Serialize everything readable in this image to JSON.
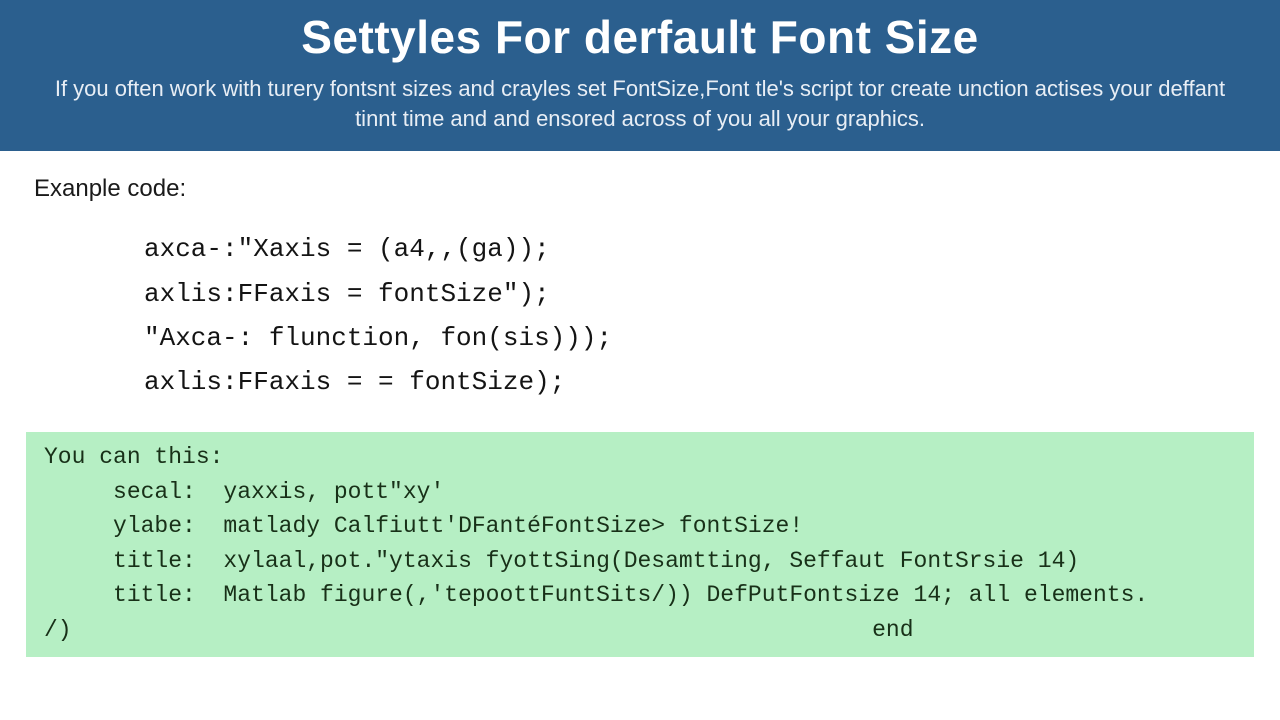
{
  "header": {
    "title": "Settyles For derfault Font Size",
    "subtitle": "If you often work with turery fontsnt sizes and crayles set FontSize,Font tle's script tor create unction actises your deffant tinnt time and and ensored across of you all your graphics."
  },
  "example": {
    "label": "Exanple code:",
    "code": "axca-:\"Xaxis = (a4,,(ga));\naxlis:FFaxis = fontSize\");\n\"Axca-: flunction, fon(sis)));\naxlis:FFaxis = = fontSize);"
  },
  "tip": {
    "text": "You can this:\n     secal:  yaxxis, pott\"xy'\n     ylabe:  matlady Calfiutt'DFantéFontSize> fontSize!\n     title:  xylaal,pot.\"ytaxis fyottSing(Desamtting, Seffaut FontSrsie 14)\n     title:  Matlab figure(,'tepoottFuntSits/)) DefPutFontsize 14; all elements.\n/)                                                          end"
  }
}
